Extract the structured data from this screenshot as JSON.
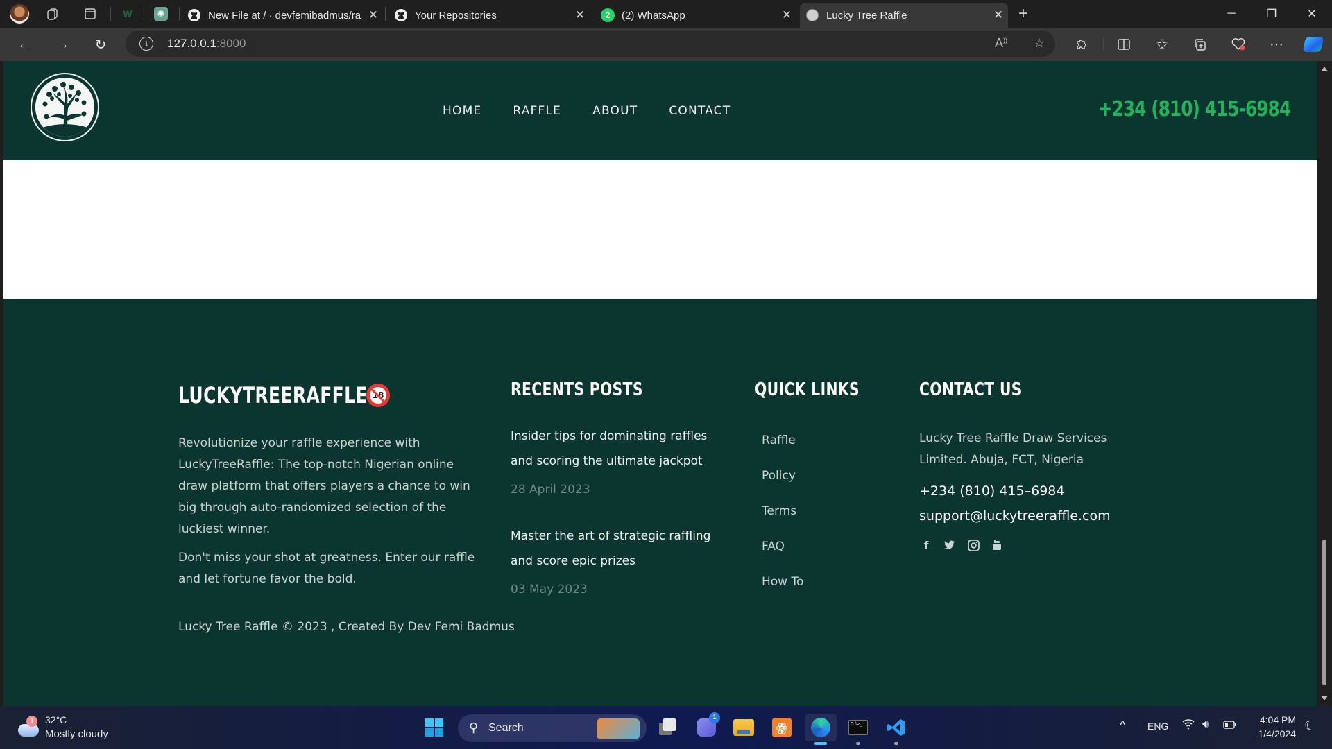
{
  "browser": {
    "tabs": [
      {
        "title": "New File at / · devfemibadmus/ra",
        "icon": "github-icon",
        "closable": true
      },
      {
        "title": "Your Repositories",
        "icon": "github-icon",
        "closable": true
      },
      {
        "title": "(2) WhatsApp",
        "icon": "whatsapp-icon",
        "badge": "2",
        "closable": true
      },
      {
        "title": "Lucky Tree Raffle",
        "icon": "tree-favicon",
        "closable": true,
        "active": true
      }
    ],
    "new_tab_symbol": "+",
    "address": {
      "host": "127.0.0.1",
      "port": ":8000"
    },
    "window_controls": {
      "minimize": "─",
      "restore": "❐",
      "close": "✕"
    }
  },
  "site": {
    "nav": [
      "HOME",
      "RAFFLE",
      "ABOUT",
      "CONTACT"
    ],
    "header_phone": "+234 (810) 415-6984",
    "colors": {
      "brand_dark": "#0b3630",
      "accent_green": "#21b25b"
    }
  },
  "footer": {
    "brand": {
      "title": "LUCKYTREERAFFLE",
      "age_badge": "18",
      "paragraphs": [
        "Revolutionize your raffle experience with LuckyTreeRaffle: The top-notch Nigerian online draw platform that offers players a chance to win big through auto-randomized selection of the luckiest winner.",
        "Don't miss your shot at greatness. Enter our raffle and let fortune favor the bold."
      ]
    },
    "recent_posts": {
      "heading": "RECENTS POSTS",
      "posts": [
        {
          "title": "Insider tips for dominating raffles and scoring the ultimate jackpot",
          "date": "28 April 2023"
        },
        {
          "title": "Master the art of strategic raffling and score epic prizes",
          "date": "03 May 2023"
        }
      ]
    },
    "quick_links": {
      "heading": "QUICK LINKS",
      "links": [
        "Raffle",
        "Policy",
        "Terms",
        "FAQ",
        "How To"
      ]
    },
    "contact": {
      "heading": "CONTACT US",
      "address": "Lucky Tree Raffle Draw Services Limited. Abuja, FCT, Nigeria",
      "phone": "+234 (810) 415–6984",
      "email": "support@luckytreeraffle.com",
      "social": [
        {
          "name": "facebook",
          "glyph": "f"
        },
        {
          "name": "twitter",
          "glyph": "🐦"
        },
        {
          "name": "instagram",
          "glyph": "◎"
        },
        {
          "name": "youtube",
          "glyph": "▶"
        }
      ]
    },
    "copyright": "Lucky Tree Raffle © 2023 , Created By Dev Femi Badmus"
  },
  "taskbar": {
    "weather": {
      "temp": "32°C",
      "condition": "Mostly cloudy",
      "badge": "1"
    },
    "search_label": "Search",
    "teams_badge": "1",
    "lang": "ENG",
    "time": "4:04 PM",
    "date": "1/4/2024"
  }
}
